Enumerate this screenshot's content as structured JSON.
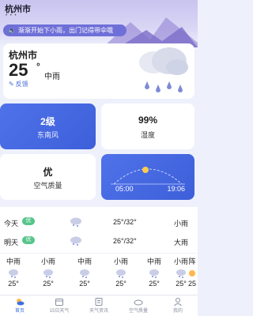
{
  "header": {
    "city": "杭州市",
    "dots": "• • •",
    "banner_text": "渐渐开始下小雨，出门记得带伞哦"
  },
  "current": {
    "city": "杭州市",
    "temperature": "25",
    "degree": "°",
    "condition": "中雨",
    "feedback_label": "反馈"
  },
  "tiles": {
    "wind_value": "2级",
    "wind_label": "东南风",
    "humidity_value": "99%",
    "humidity_label": "湿度",
    "aqi_value": "优",
    "aqi_label": "空气质量",
    "sunrise": "05:00",
    "sunset": "19:06"
  },
  "forecast": [
    {
      "day": "今天",
      "aqi": "优",
      "temp": "25°/32°",
      "cond": "小雨"
    },
    {
      "day": "明天",
      "aqi": "优",
      "temp": "26°/32°",
      "cond": "大雨"
    }
  ],
  "hourly": [
    {
      "cond": "中雨",
      "temp": "25°"
    },
    {
      "cond": "小雨",
      "temp": "25°"
    },
    {
      "cond": "中雨",
      "temp": "25°"
    },
    {
      "cond": "小雨",
      "temp": "25°"
    },
    {
      "cond": "中雨",
      "temp": "25°"
    },
    {
      "cond": "小雨",
      "temp": "25°"
    },
    {
      "cond": "阵",
      "temp": "25"
    }
  ],
  "tabs": [
    {
      "label": "首页"
    },
    {
      "label": "15日天气"
    },
    {
      "label": "天气资讯"
    },
    {
      "label": "空气质量"
    },
    {
      "label": "我的"
    }
  ],
  "colors": {
    "accent": "#3d6fe0",
    "tile_blue": "#4f72ea",
    "banner": "#6f6fd8",
    "aqi_green": "#56c58a"
  }
}
